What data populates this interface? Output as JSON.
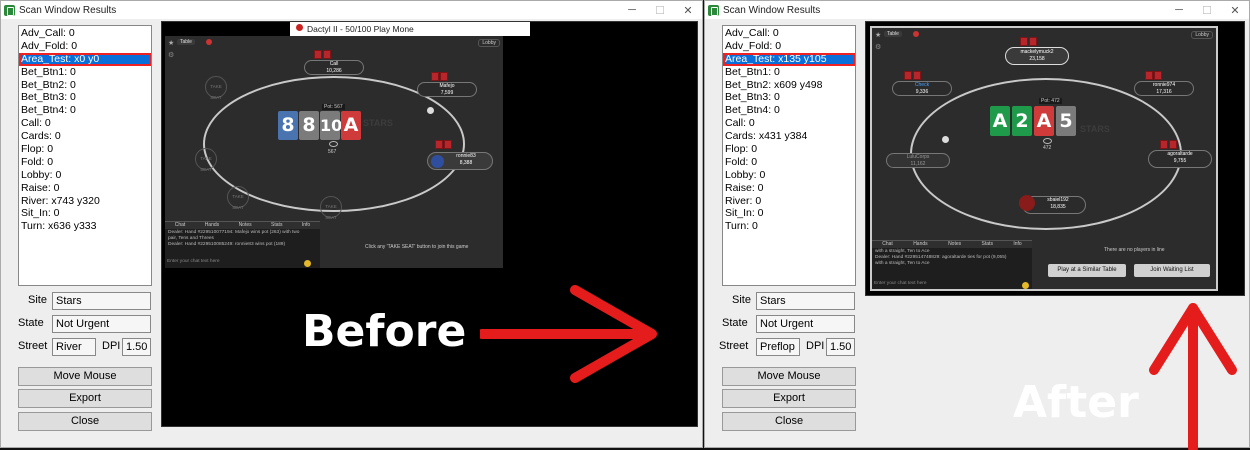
{
  "window_title": "Scan Window Results",
  "controls": {
    "minimize": "─",
    "maximize": "☐",
    "close": "✕"
  },
  "left": {
    "items": [
      "Adv_Call: 0",
      "Adv_Fold: 0",
      "Area_Test: x0 y0",
      "Bet_Btn1: 0",
      "Bet_Btn2: 0",
      "Bet_Btn3: 0",
      "Bet_Btn4: 0",
      "Call: 0",
      "Cards: 0",
      "Flop: 0",
      "Fold: 0",
      "Lobby: 0",
      "Raise: 0",
      "River: x743 y320",
      "Sit_In: 0",
      "Turn: x636 y333"
    ],
    "selected_index": 2,
    "site_label": "Site",
    "site_value": "Stars",
    "state_label": "State",
    "state_value": "Not Urgent",
    "street_label": "Street",
    "street_value": "River",
    "dpi_label": "DPI",
    "dpi_value": "1.50",
    "move_mouse": "Move Mouse",
    "export": "Export",
    "close": "Close",
    "overlay_text": "Before"
  },
  "right": {
    "items": [
      "Adv_Call: 0",
      "Adv_Fold: 0",
      "Area_Test: x135 y105",
      "Bet_Btn1: 0",
      "Bet_Btn2: x609 y498",
      "Bet_Btn3: 0",
      "Bet_Btn4: 0",
      "Call: 0",
      "Cards: x431 y384",
      "Flop: 0",
      "Fold: 0",
      "Lobby: 0",
      "Raise: 0",
      "River: 0",
      "Sit_In: 0",
      "Turn: 0"
    ],
    "selected_index": 2,
    "site_label": "Site",
    "site_value": "Stars",
    "state_label": "State",
    "state_value": "Not Urgent",
    "street_label": "Street",
    "street_value": "Preflop",
    "dpi_label": "DPI",
    "dpi_value": "1.50",
    "move_mouse": "Move Mouse",
    "export": "Export",
    "close": "Close",
    "overlay_text": "After"
  },
  "shot1": {
    "table_tab": "Table",
    "lobby": "Lobby",
    "partial_title": "Dactyl II - 50/100 Play Mone",
    "p_top_name": "Call",
    "p_top_stack": "10,286",
    "p_right_name": "Mafejo",
    "p_right_stack": "7,599",
    "p_hero_name": "ronnie83",
    "p_hero_stack": "8,388",
    "pot": "Pot: 567",
    "pot2": "567",
    "cards": [
      "8",
      "8",
      "10",
      "A"
    ],
    "take_seat": "TAKE SEAT",
    "chat_tabs": [
      "Chat",
      "Hands",
      "Notes",
      "Stats",
      "Info"
    ],
    "chat_lines": [
      "Dealer: Hand #229510077194: Mafejo wins pot (263) with two",
      "pair, Tens and Threes",
      "Dealer: Hand #229510085249: ronnie83 wins pot (189)"
    ],
    "chat_placeholder": "Enter your chat text here",
    "join_hint": "Click any 'TAKE SEAT' button to join this game",
    "watermark": "STARS"
  },
  "shot2": {
    "table_tab": "Table",
    "lobby": "Lobby",
    "p_top_name": "mackelymuck2",
    "p_top_stack": "23,158",
    "p_left_name": "Check",
    "p_left_stack": "9,336",
    "p_right_name": "ronnie974",
    "p_right_stack": "17,316",
    "p_lowleft_name": "LuluCorps",
    "p_lowleft_stack": "11,162",
    "p_lowright_name": "agoraltarde",
    "p_lowright_stack": "9,755",
    "p_bottom_name": "sbaiel192",
    "p_bottom_stack": "18,835",
    "pot": "Pot: 472",
    "pot2": "472",
    "cards": [
      "A",
      "2",
      "A",
      "5"
    ],
    "chat_tabs": [
      "Chat",
      "Hands",
      "Notes",
      "Stats",
      "Info"
    ],
    "chat_lines": [
      "with a straight, Ten to Ace",
      "Dealer: Hand #229514748829: agoraltarde ties for pot (9,055)",
      "with a straight, Ten to Ace"
    ],
    "chat_placeholder": "Enter your chat text here",
    "no_players": "There are no players in line",
    "btn_similar": "Play at a Similar Table",
    "btn_waiting": "Join Waiting List",
    "watermark": "STARS"
  },
  "colors": {
    "selection": "#0a6fd8",
    "selection_outline": "#e22222",
    "arrow": "#e51c1c",
    "card_blue": "#4a74b0",
    "card_green": "#1f9a4a",
    "card_red": "#cf3a3a",
    "card_gray": "#7b7b7b"
  }
}
